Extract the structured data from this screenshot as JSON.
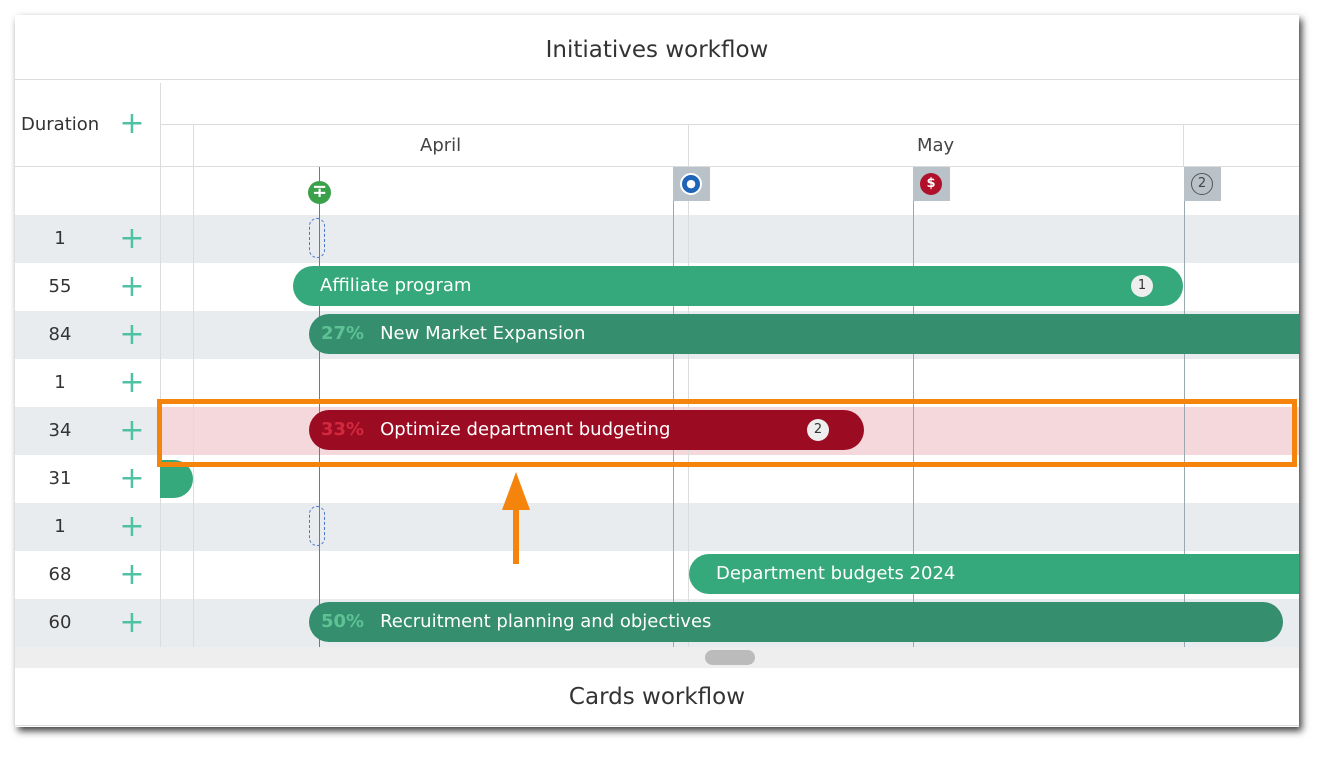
{
  "header": {
    "title": "Initiatives workflow"
  },
  "footer": {
    "title": "Cards workflow"
  },
  "columns": {
    "duration_label": "Duration",
    "add_icon": "plus-icon"
  },
  "timeline": {
    "months": [
      "April",
      "May"
    ],
    "milestones": [
      {
        "icon": "water-drop-icon",
        "color": "#1f64b7",
        "glyph": "●"
      },
      {
        "icon": "dollar-icon",
        "color": "#b0102a",
        "glyph": "$"
      },
      {
        "icon": "number-2-icon",
        "color": "#b8c2c8",
        "glyph": "2"
      }
    ],
    "today_icon": "today-marker-icon"
  },
  "rows": [
    {
      "duration": "1"
    },
    {
      "duration": "55",
      "bar": {
        "label": "Affiliate program",
        "badge": "1"
      }
    },
    {
      "duration": "84",
      "bar": {
        "label": "New Market Expansion",
        "progress": "27%"
      }
    },
    {
      "duration": "1"
    },
    {
      "duration": "34",
      "bar": {
        "label": "Optimize department budgeting",
        "progress": "33%",
        "badge": "2"
      }
    },
    {
      "duration": "31"
    },
    {
      "duration": "1"
    },
    {
      "duration": "68",
      "bar": {
        "label": "Department budgets 2024"
      }
    },
    {
      "duration": "60",
      "bar": {
        "label": "Recruitment planning and objectives",
        "progress": "50%"
      }
    }
  ],
  "colors": {
    "bar_green": "#35a97b",
    "bar_dark_green": "#358e6d",
    "bar_red": "#9b0c23",
    "row_highlight": "#f5d8dc",
    "annotation_orange": "#f5840c",
    "plus_teal": "#4fc2a4"
  }
}
